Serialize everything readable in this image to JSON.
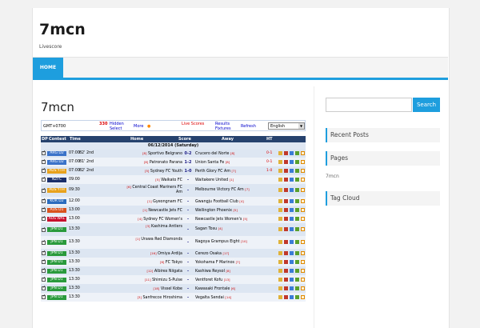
{
  "site": {
    "title": "7mcn",
    "description": "Livescore"
  },
  "nav": {
    "home": "HOME"
  },
  "page": {
    "title": "7mcn"
  },
  "controls": {
    "gmt": "GMT+0700",
    "hidden_count": "330",
    "hidden": "Hidden",
    "select": "Select",
    "more": "More",
    "live_scores": "Live Scores",
    "results": "Results",
    "fixtures": "Fixtures",
    "refresh": "Refresh",
    "language": "English"
  },
  "table": {
    "headers": {
      "dp": "DP",
      "contest": "Contest",
      "time": "Time",
      "home": "Home",
      "score": "Score",
      "away": "Away",
      "ht": "HT"
    },
    "date": "06/12/2014 (Saturday)",
    "rows": [
      {
        "league": "ARG D2",
        "color": "#3b73c9",
        "time": "07:00",
        "status": "82' 2nd",
        "home_rank": "[8]",
        "home": "Sportivo Belgrano",
        "score": "0-2",
        "away": "Crucero del Norte",
        "away_rank": "[8]",
        "ht": "0-1"
      },
      {
        "league": "ARG D2",
        "color": "#3b73c9",
        "time": "07:00",
        "status": "81' 2nd",
        "home_rank": "[8]",
        "home": "Patronato Parana",
        "score": "1-2",
        "away": "Union Santa Fe",
        "away_rank": "[8]",
        "ht": "0-1"
      },
      {
        "league": "AUS YTH",
        "color": "#e8a21c",
        "time": "07:00",
        "status": "82' 2nd",
        "home_rank": "[5]",
        "home": "Sydney FC Youth",
        "score": "1-0",
        "away": "Perth Glory FC Am",
        "away_rank": "[7]",
        "ht": "1-0"
      },
      {
        "league": "NZFC",
        "color": "#1a2f6b",
        "time": "09:00",
        "status": "",
        "home_rank": "[5]",
        "home": "Waikato FC",
        "score": "-",
        "away": "Waitakere United",
        "away_rank": "[1]",
        "ht": ""
      },
      {
        "league": "AUS YTH",
        "color": "#e8a21c",
        "time": "09:30",
        "status": "",
        "home_rank": "[6]",
        "home": "Central Coast Mariners FC Am",
        "score": "-",
        "away": "Melbourne Victory FC Am",
        "away_rank": "[7]",
        "ht": ""
      },
      {
        "league": "KOR D2",
        "color": "#2c6cbe",
        "time": "12:00",
        "status": "",
        "home_rank": "[1]",
        "home": "Gyeongnam FC",
        "score": "-",
        "away": "Gwangju Football Club",
        "away_rank": "[4]",
        "ht": ""
      },
      {
        "league": "AUS D1",
        "color": "#d9531e",
        "time": "13:00",
        "status": "",
        "home_rank": "[1]",
        "home": "Newcastle Jets FC",
        "score": "-",
        "away": "Wellington Phoenix",
        "away_rank": "[5]",
        "ht": ""
      },
      {
        "league": "AUS WAL",
        "color": "#c8102e",
        "time": "13:00",
        "status": "",
        "home_rank": "[4]",
        "home": "Sydney FC Women's",
        "score": "-",
        "away": "Newcastle Jets Women's",
        "away_rank": "[5]",
        "ht": ""
      },
      {
        "league": "JPN D1",
        "color": "#2a9a3c",
        "time": "13:30",
        "status": "",
        "home_rank": "[3]",
        "home": "Kashima Antlers",
        "score": "-",
        "away": "Sagan Tosu",
        "away_rank": "[4]",
        "ht": ""
      },
      {
        "league": "JPN D1",
        "color": "#2a9a3c",
        "time": "13:30",
        "status": "",
        "home_rank": "[1]",
        "home": "Urawa Red Diamonds",
        "score": "-",
        "away": "Nagoya Grampus Eight",
        "away_rank": "[10]",
        "ht": ""
      },
      {
        "league": "JPN D1",
        "color": "#2a9a3c",
        "time": "13:30",
        "status": "",
        "home_rank": "[16]",
        "home": "Omiya Ardija",
        "score": "-",
        "away": "Cerezo Osaka",
        "away_rank": "[17]",
        "ht": ""
      },
      {
        "league": "JPN D1",
        "color": "#2a9a3c",
        "time": "13:30",
        "status": "",
        "home_rank": "[6]",
        "home": "FC Tokyo",
        "score": "-",
        "away": "Yokohama F Marinos",
        "away_rank": "[7]",
        "ht": ""
      },
      {
        "league": "JPN D1",
        "color": "#2a9a3c",
        "time": "13:30",
        "status": "",
        "home_rank": "[12]",
        "home": "Albirex Niigata",
        "score": "-",
        "away": "Kashiwa Reysol",
        "away_rank": "[8]",
        "ht": ""
      },
      {
        "league": "JPN D1",
        "color": "#2a9a3c",
        "time": "13:30",
        "status": "",
        "home_rank": "[11]",
        "home": "Shimizu S-Pulse",
        "score": "-",
        "away": "Ventforet Kofu",
        "away_rank": "[13]",
        "ht": ""
      },
      {
        "league": "JPN D1",
        "color": "#2a9a3c",
        "time": "13:30",
        "status": "",
        "home_rank": "[18]",
        "home": "Vissel Kobe",
        "score": "-",
        "away": "Kawasaki Frontale",
        "away_rank": "[6]",
        "ht": ""
      },
      {
        "league": "JPN D1",
        "color": "#2a9a3c",
        "time": "13:30",
        "status": "",
        "home_rank": "[3]",
        "home": "Sanfrecce Hiroshima",
        "score": "-",
        "away": "Vegalta Sendai",
        "away_rank": "[14]",
        "ht": ""
      }
    ]
  },
  "sidebar": {
    "search_button": "Search",
    "recent_posts": "Recent Posts",
    "pages": "Pages",
    "page_link": "7mcn",
    "tag_cloud": "Tag Cloud"
  }
}
